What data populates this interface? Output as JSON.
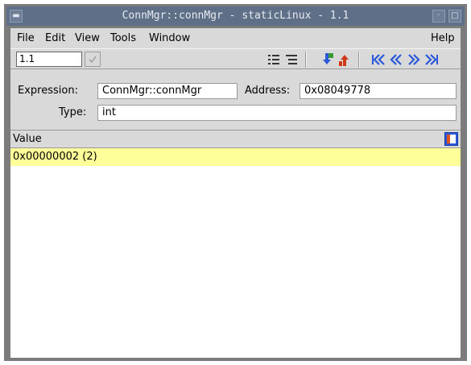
{
  "window": {
    "title": "ConnMgr::connMgr - staticLinux - 1.1"
  },
  "menu": {
    "file": "File",
    "edit": "Edit",
    "view": "View",
    "tools": "Tools",
    "window": "Window",
    "help": "Help"
  },
  "toolbar": {
    "thread_value": "1.1",
    "icons": [
      "tree-collapse-icon",
      "tree-expand-icon",
      "dive-down-icon",
      "undive-up-icon",
      "first-icon",
      "previous-icon",
      "next-icon",
      "last-icon"
    ]
  },
  "fields": {
    "expression_label": "Expression:",
    "expression_value": "ConnMgr::connMgr",
    "address_label": "Address:",
    "address_value": "0x08049778",
    "type_label": "Type:",
    "type_value": "int"
  },
  "panel": {
    "column_header": "Value",
    "rows": [
      {
        "value": "0x00000002 (2)"
      }
    ]
  },
  "colors": {
    "selected_row": "#ffff99",
    "titlebar": "#5f6f88",
    "accent_blue": "#2a58d8"
  }
}
